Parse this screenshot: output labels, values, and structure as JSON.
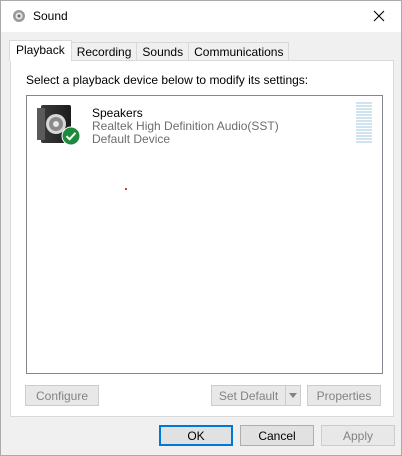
{
  "window": {
    "title": "Sound"
  },
  "tabs": [
    {
      "label": "Playback",
      "active": true
    },
    {
      "label": "Recording",
      "active": false
    },
    {
      "label": "Sounds",
      "active": false
    },
    {
      "label": "Communications",
      "active": false
    }
  ],
  "playback": {
    "instruction": "Select a playback device below to modify its settings:",
    "devices": [
      {
        "name": "Speakers",
        "driver": "Realtek High Definition Audio(SST)",
        "status": "Default Device",
        "icon": "speaker-icon",
        "badge_icon": "check-badge-icon"
      }
    ],
    "buttons": {
      "configure": "Configure",
      "set_default": "Set Default",
      "properties": "Properties"
    }
  },
  "dialog_buttons": {
    "ok": "OK",
    "cancel": "Cancel",
    "apply": "Apply"
  },
  "colors": {
    "accent": "#0078d7",
    "badge_green": "#1e8a3c",
    "meter": "#cfe4ee"
  }
}
